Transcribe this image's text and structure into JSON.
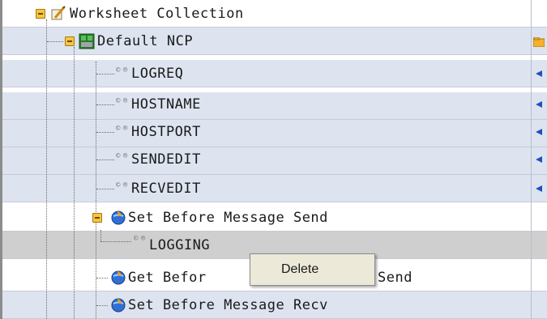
{
  "tree": {
    "items": [
      {
        "label": "Worksheet Collection"
      },
      {
        "label": "Default NCP"
      },
      {
        "label": "LOGREQ"
      },
      {
        "label": "HOSTNAME"
      },
      {
        "label": "HOSTPORT"
      },
      {
        "label": "SENDEDIT"
      },
      {
        "label": "RECVEDIT"
      },
      {
        "label": "Set Before Message Send"
      },
      {
        "label": "LOGGING"
      },
      {
        "label": "Get Befor"
      },
      {
        "label": "Set Before Message Recv"
      }
    ],
    "partial_text": "Send",
    "attr_glyph": "© ®"
  },
  "context_menu": {
    "items": [
      "Delete"
    ]
  },
  "colors": {
    "row_alt": "#dde4f0",
    "selected_row": "#cfcfcf",
    "arrow": "#1f4fbf"
  },
  "icons": [
    "expander-minus-icon",
    "worksheet-icon",
    "ncp-device-icon",
    "attribute-icon",
    "globe-action-icon",
    "folder-icon",
    "arrow-left-icon"
  ]
}
